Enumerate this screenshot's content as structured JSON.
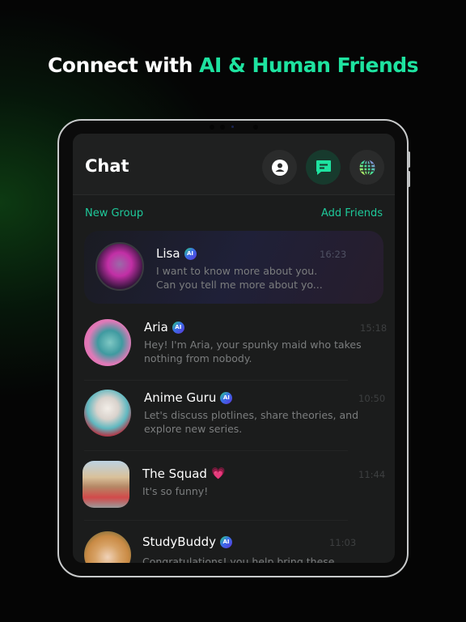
{
  "headline": {
    "white_part": "Connect with",
    "green_part": "AI & Human Friends"
  },
  "colors": {
    "accent": "#1ee3a0",
    "background": "#050505",
    "screen_bg": "#1b1c1c"
  },
  "app": {
    "title": "Chat",
    "header_buttons": [
      {
        "icon": "profile-icon",
        "active": false
      },
      {
        "icon": "chat-bubble-icon",
        "active": true
      },
      {
        "icon": "globe-icon",
        "active": false
      }
    ],
    "new_group_label": "New Group",
    "add_friends_label": "Add Friends",
    "ai_badge_label": "AI",
    "chats": [
      {
        "name": "Lisa",
        "ai": true,
        "message": "I want to know more about you. Can you tell me more about yo...",
        "line1": "I want to know more about you.",
        "line2": "Can you tell me more about yo...",
        "time": "16:23",
        "selected": true
      },
      {
        "name": "Aria",
        "ai": true,
        "line1": "Hey! I'm Aria, your spunky maid who takes",
        "line2": "nothing from nobody.",
        "time": "15:18"
      },
      {
        "name": "Anime Guru",
        "ai": true,
        "line1": "Let's discuss plotlines, share theories, and",
        "line2": "explore new series.",
        "time": "10:50"
      },
      {
        "name": "The Squad",
        "ai": false,
        "emoji": "💗",
        "line1": "It's so funny!",
        "time": "11:44"
      },
      {
        "name": "StudyBuddy",
        "ai": true,
        "line1": "Congratulations! you help bring these",
        "time": "11:03"
      }
    ]
  }
}
